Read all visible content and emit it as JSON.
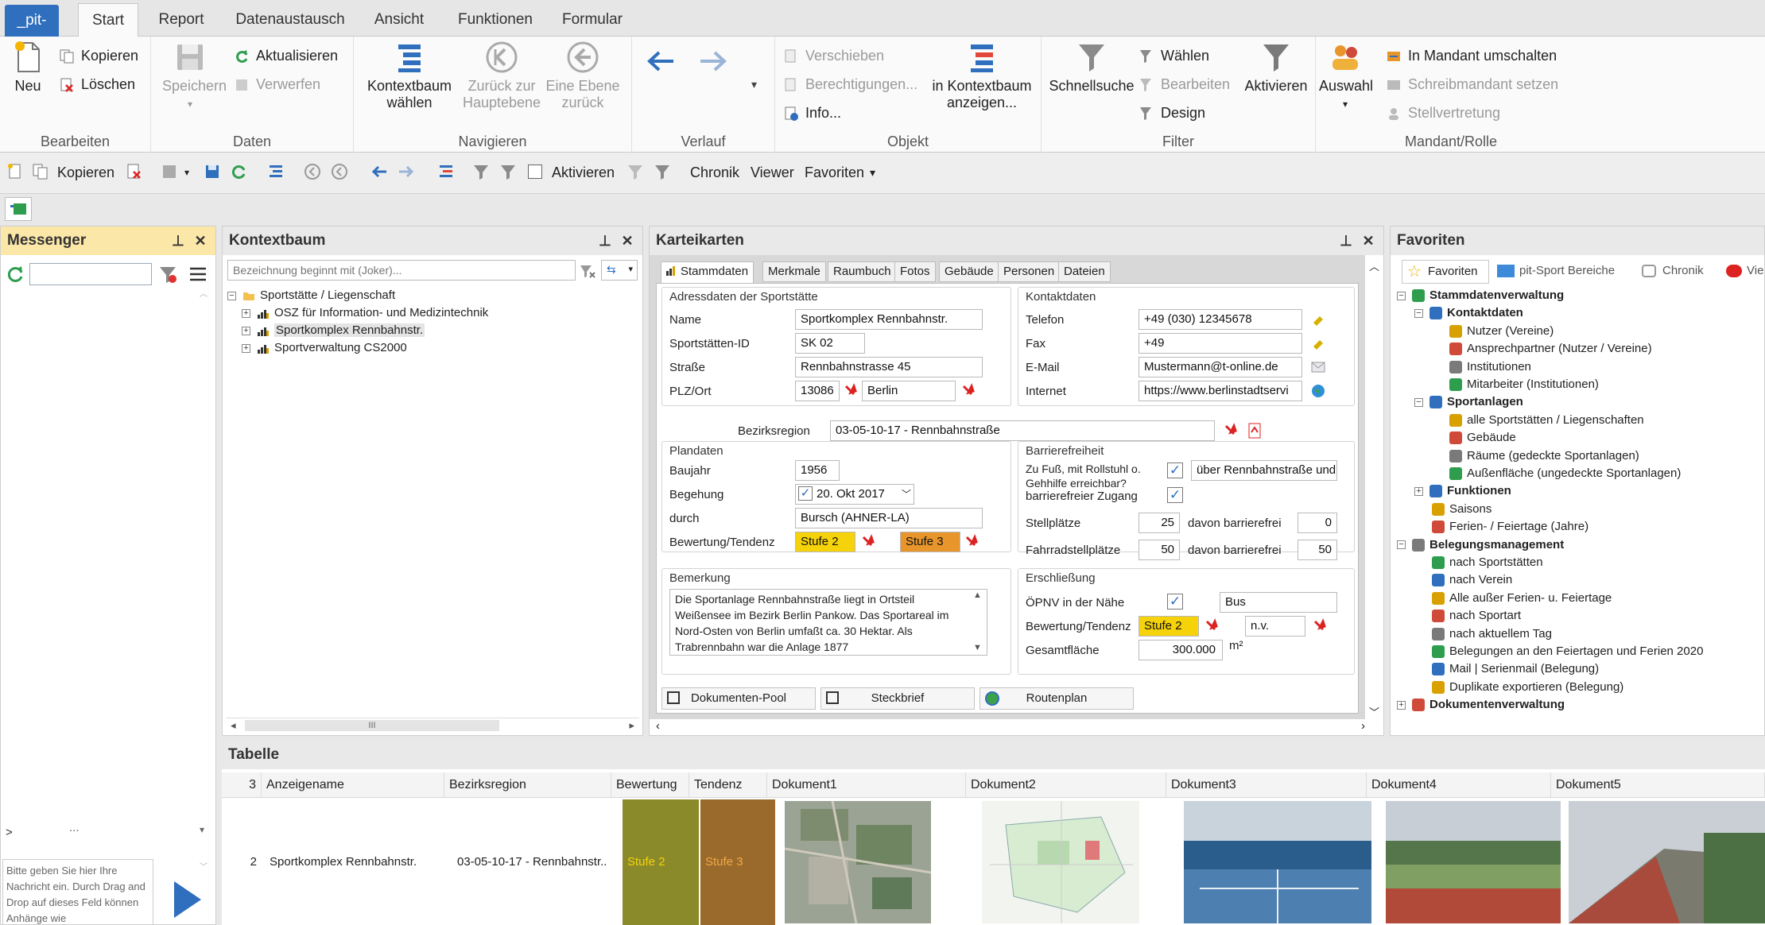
{
  "ribbon_tabs": [
    "_pit-",
    "Start",
    "Report",
    "Datenaustausch",
    "Ansicht",
    "Funktionen",
    "Formular"
  ],
  "ribbon": {
    "bearbeiten": {
      "new": "Neu",
      "copy": "Kopieren",
      "delete": "Löschen",
      "label": "Bearbeiten"
    },
    "daten": {
      "save": "Speichern",
      "refresh": "Aktualisieren",
      "discard": "Verwerfen",
      "label": "Daten"
    },
    "navigieren": {
      "context": "Kontextbaum wählen",
      "main": "Zurück zur Hauptebene",
      "up": "Eine Ebene zurück",
      "label": "Navigieren"
    },
    "verlauf": {
      "label": "Verlauf"
    },
    "objekt": {
      "move": "Verschieben",
      "perms": "Berechtigungen...",
      "info": "Info...",
      "show": "in Kontextbaum anzeigen...",
      "label": "Objekt"
    },
    "filter": {
      "quick": "Schnellsuche",
      "select": "Wählen",
      "edit": "Bearbeiten",
      "design": "Design",
      "activate": "Aktivieren",
      "label": "Filter"
    },
    "mandant": {
      "auswahl": "Auswahl",
      "switch": "In Mandant umschalten",
      "write": "Schreibmandant setzen",
      "deputy": "Stellvertretung",
      "label": "Mandant/Rolle"
    }
  },
  "qat": {
    "copy": "Kopieren",
    "activate": "Aktivieren",
    "chronik": "Chronik",
    "viewer": "Viewer",
    "favoriten": "Favoriten"
  },
  "messenger": {
    "title": "Messenger",
    "prompt": "Bitte geben Sie hier Ihre Nachricht ein. Durch Drag and Drop auf dieses Feld können Anhänge wie",
    "more": ">",
    "dots": "..."
  },
  "kontextbaum": {
    "title": "Kontextbaum",
    "filter_placeholder": "Bezeichnung beginnt mit (Joker)...",
    "root": "Sportstätte / Liegenschaft",
    "items": [
      "OSZ für Information- und Medizintechnik",
      "Sportkomplex Rennbahnstr.",
      "Sportverwaltung CS2000"
    ],
    "scroll": "III"
  },
  "karteikarten": {
    "title": "Karteikarten",
    "tabs": [
      "Stammdaten",
      "Merkmale",
      "Raumbuch",
      "Fotos",
      "Gebäude",
      "Personen",
      "Dateien"
    ],
    "adress": {
      "title": "Adressdaten der Sportstätte",
      "name_l": "Name",
      "name": "Sportkomplex Rennbahnstr.",
      "id_l": "Sportstätten-ID",
      "id": "SK 02",
      "street_l": "Straße",
      "street": "Rennbahnstrasse 45",
      "plz_l": "PLZ/Ort",
      "plz": "13086",
      "ort": "Berlin"
    },
    "kontakt": {
      "title": "Kontaktdaten",
      "tel_l": "Telefon",
      "tel": "+49 (030) 12345678",
      "fax_l": "Fax",
      "fax": "+49",
      "mail_l": "E-Mail",
      "mail": "Mustermann@t-online.de",
      "web_l": "Internet",
      "web": "https://www.berlinstadtservi"
    },
    "bezirk": {
      "label": "Bezirksregion",
      "value": "03-05-10-17 - Rennbahnstraße"
    },
    "plan": {
      "title": "Plandaten",
      "baujahr_l": "Baujahr",
      "baujahr": "1956",
      "begehung_l": "Begehung",
      "begehung": "20. Okt 2017",
      "durch_l": "durch",
      "durch": "Bursch (AHNER-LA)",
      "bew_l": "Bewertung/Tendenz",
      "bew": "Stufe 2",
      "tend": "Stufe 3"
    },
    "barriere": {
      "title": "Barrierefreiheit",
      "q1": "Zu Fuß, mit Rollstuhl o. Gehhilfe erreichbar?",
      "q1_text": "über Rennbahnstraße und",
      "q2": "barrierefreier Zugang",
      "stell_l": "Stellplätze",
      "stell": "25",
      "davon_l": "davon barrierefrei",
      "davon": "0",
      "fahr_l": "Fahrradstellplätze",
      "fahr": "50",
      "davon2": "50"
    },
    "bemerkung": {
      "title": "Bemerkung",
      "text": "Die Sportanlage Rennbahnstraße liegt in Ortsteil Weißensee im Bezirk Berlin Pankow. Das Sportareal im Nord-Osten von Berlin umfaßt ca. 30 Hektar. Als Trabrennbahn war die Anlage 1877"
    },
    "erschl": {
      "title": "Erschließung",
      "oepnv_l": "ÖPNV in der Nähe",
      "oepnv": "Bus",
      "bew_l": "Bewertung/Tendenz",
      "bew": "Stufe 2",
      "tend": "n.v.",
      "flaeche_l": "Gesamtfläche",
      "flaeche": "300.000",
      "unit": "m²"
    },
    "buttons": [
      "Dokumenten-Pool",
      "Steckbrief",
      "Routenplan"
    ]
  },
  "favoriten": {
    "title": "Favoriten",
    "tabs": [
      "Favoriten",
      "pit-Sport Bereiche",
      "Chronik",
      "Vie"
    ],
    "tree": [
      {
        "t": "Stammdatenverwaltung",
        "lvl": 0,
        "bold": true
      },
      {
        "t": "Kontaktdaten",
        "lvl": 1,
        "bold": true
      },
      {
        "t": "Nutzer (Vereine)",
        "lvl": 2
      },
      {
        "t": "Ansprechpartner (Nutzer / Vereine)",
        "lvl": 2
      },
      {
        "t": "Institutionen",
        "lvl": 2
      },
      {
        "t": "Mitarbeiter (Institutionen)",
        "lvl": 2
      },
      {
        "t": "Sportanlagen",
        "lvl": 1,
        "bold": true
      },
      {
        "t": "alle Sportstätten / Liegenschaften",
        "lvl": 2
      },
      {
        "t": "Gebäude",
        "lvl": 2
      },
      {
        "t": "Räume (gedeckte Sportanlagen)",
        "lvl": 2
      },
      {
        "t": "Außenfläche (ungedeckte Sportanlagen)",
        "lvl": 2
      },
      {
        "t": "Funktionen",
        "lvl": 1,
        "bold": true
      },
      {
        "t": "Saisons",
        "lvl": 1
      },
      {
        "t": "Ferien- / Feiertage (Jahre)",
        "lvl": 1
      },
      {
        "t": "Belegungsmanagement",
        "lvl": 0,
        "bold": true
      },
      {
        "t": "nach Sportstätten",
        "lvl": 1
      },
      {
        "t": "nach Verein",
        "lvl": 1
      },
      {
        "t": "Alle außer Ferien- u. Feiertage",
        "lvl": 1
      },
      {
        "t": "nach Sportart",
        "lvl": 1
      },
      {
        "t": "nach aktuellem Tag",
        "lvl": 1
      },
      {
        "t": "Belegungen an den Feiertagen und Ferien 2020",
        "lvl": 1
      },
      {
        "t": "Mail | Serienmail (Belegung)",
        "lvl": 1
      },
      {
        "t": "Duplikate exportieren (Belegung)",
        "lvl": 1
      },
      {
        "t": "Dokumentenverwaltung",
        "lvl": 0,
        "bold": true
      }
    ]
  },
  "tabelle": {
    "title": "Tabelle",
    "count": "3",
    "columns": [
      "Anzeigename",
      "Bezirksregion",
      "Bewertung",
      "Tendenz",
      "Dokument1",
      "Dokument2",
      "Dokument3",
      "Dokument4",
      "Dokument5"
    ],
    "row": {
      "num": "2",
      "name": "Sportkomplex Rennbahnstr.",
      "bezirk": "03-05-10-17 - Rennbahnstr...",
      "bew": "Stufe 2",
      "tend": "Stufe 3"
    }
  },
  "colors": {
    "accent": "#2f6fbd",
    "stufe2": "#f5d20a",
    "stufe3": "#e8952c",
    "bew_cell": "#8a8a2a",
    "tend_cell": "#9a6a2c"
  }
}
